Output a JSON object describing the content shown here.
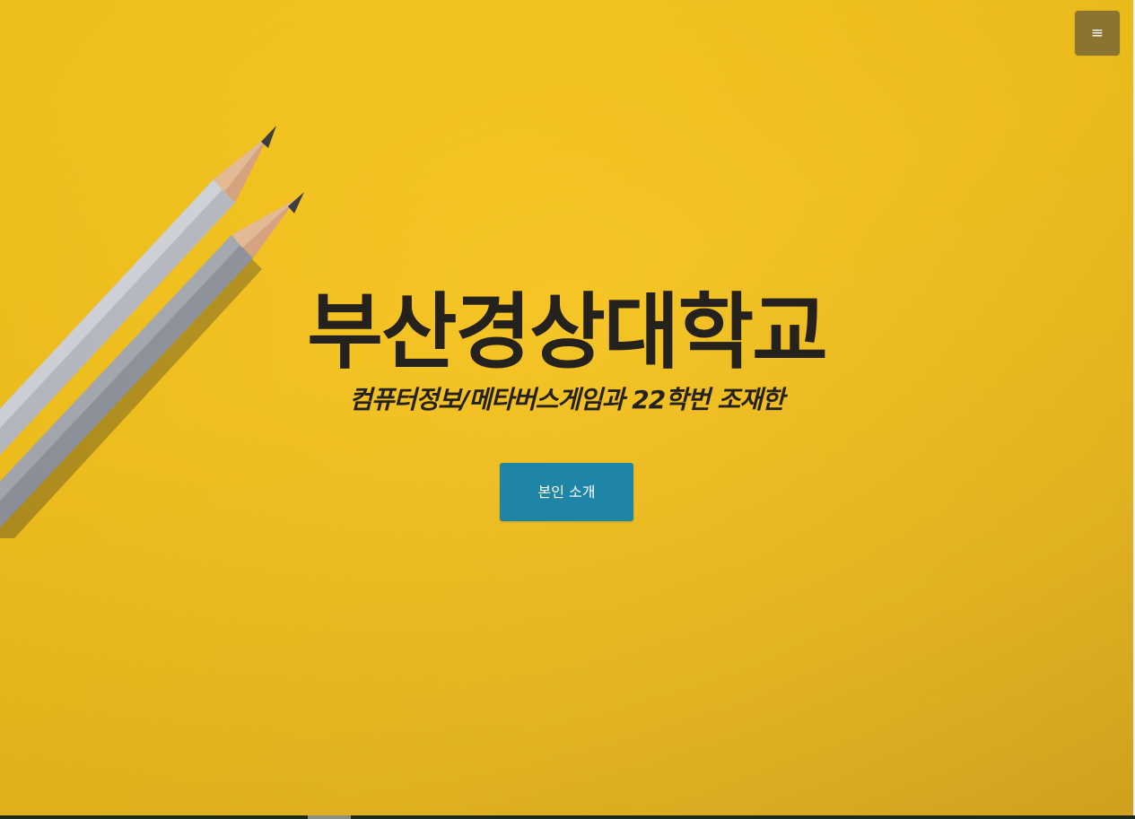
{
  "menu": {
    "icon_glyph": "≡",
    "icon": "hamburger-menu-icon"
  },
  "hero": {
    "title": "부산경상대학교",
    "subtitle": "컴퓨터정보/메타버스게임과 22학번 조재한",
    "cta_label": "본인 소개",
    "background_color": "#f6c21a",
    "text_color": "#25211c",
    "cta_color": "#1f85a7",
    "menu_color": "#8b7330"
  },
  "decoration": {
    "image": "pencils-illustration"
  }
}
